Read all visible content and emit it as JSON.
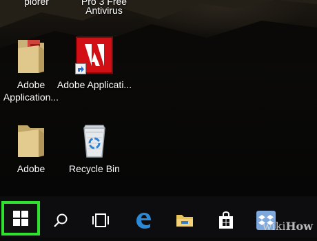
{
  "desktop": {
    "top_labels": {
      "left": "plorer",
      "right_line1": "Pro 3 Free",
      "right_line2": "Antivirus"
    },
    "icons": [
      {
        "label": "Adobe Application...",
        "icon": "folder-pdf-icon"
      },
      {
        "label": "Adobe Applicati...",
        "icon": "adobe-app-icon"
      },
      {
        "label": "Adobe",
        "icon": "folder-icon"
      },
      {
        "label": "Recycle Bin",
        "icon": "recycle-bin-icon"
      }
    ]
  },
  "taskbar": {
    "items": [
      {
        "name": "start",
        "icon": "windows-logo-icon"
      },
      {
        "name": "search",
        "icon": "search-icon"
      },
      {
        "name": "task-view",
        "icon": "task-view-icon"
      },
      {
        "name": "edge",
        "icon": "edge-icon"
      },
      {
        "name": "file-explorer",
        "icon": "folder-icon"
      },
      {
        "name": "store",
        "icon": "store-icon"
      },
      {
        "name": "dropbox",
        "icon": "dropbox-icon"
      }
    ],
    "highlight_color": "#2ee22e"
  },
  "watermark": {
    "part1": "wiki",
    "part2": "How"
  }
}
